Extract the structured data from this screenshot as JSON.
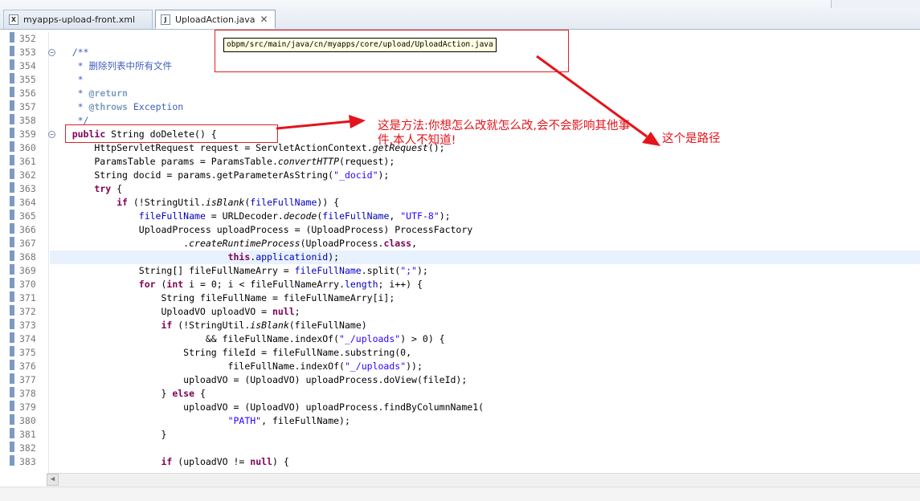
{
  "tabs": [
    {
      "icon": "X",
      "label": "myapps-upload-front.xml",
      "active": false
    },
    {
      "icon": "J",
      "label": "UploadAction.java",
      "close": "✕",
      "active": true
    }
  ],
  "editor": {
    "current_line": "368",
    "lines": [
      {
        "n": "352",
        "fold": "",
        "html": ""
      },
      {
        "n": "353",
        "fold": "⊖",
        "html": "    <span class=\"cmt\">/**</span>"
      },
      {
        "n": "354",
        "fold": "",
        "html": "     <span class=\"cmt\">* 删除列表中所有文件</span>"
      },
      {
        "n": "355",
        "fold": "",
        "html": "     <span class=\"cmt\">*</span>"
      },
      {
        "n": "356",
        "fold": "",
        "html": "     <span class=\"cmt\">* </span><span class=\"tag\">@return</span>"
      },
      {
        "n": "357",
        "fold": "",
        "html": "     <span class=\"cmt\">* </span><span class=\"tag\">@throws</span><span class=\"cmt\"> Exception</span>"
      },
      {
        "n": "358",
        "fold": "",
        "html": "     <span class=\"cmt\">*/</span>"
      },
      {
        "n": "359",
        "fold": "⊖",
        "html": "    <span class=\"kw\">public</span> String doDelete() {"
      },
      {
        "n": "360",
        "fold": "",
        "html": "        HttpServletRequest request = ServletActionContext.<span class=\"it\">getRequest</span>();"
      },
      {
        "n": "361",
        "fold": "",
        "html": "        ParamsTable params = ParamsTable.<span class=\"it\">convertHTTP</span>(request);"
      },
      {
        "n": "362",
        "fold": "",
        "html": "        String docid = params.getParameterAsString(<span class=\"str\">\"_docid\"</span>);"
      },
      {
        "n": "363",
        "fold": "",
        "html": "        <span class=\"kw\">try</span> {"
      },
      {
        "n": "364",
        "fold": "",
        "html": "            <span class=\"kw\">if</span> (!StringUtil.<span class=\"it\">isBlank</span>(<span class=\"fld\">fileFullName</span>)) {"
      },
      {
        "n": "365",
        "fold": "",
        "html": "                <span class=\"fld\">fileFullName</span> = URLDecoder.<span class=\"it\">decode</span>(<span class=\"fld\">fileFullName</span>, <span class=\"str\">\"UTF-8\"</span>);"
      },
      {
        "n": "366",
        "fold": "",
        "html": "                UploadProcess uploadProcess = (UploadProcess) ProcessFactory"
      },
      {
        "n": "367",
        "fold": "",
        "html": "                        .<span class=\"it\">createRuntimeProcess</span>(UploadProcess.<span class=\"kw\">class</span>,"
      },
      {
        "n": "368",
        "fold": "",
        "html": "                                <span class=\"kw\">this</span>.<span class=\"fld\">applicationid</span>);"
      },
      {
        "n": "369",
        "fold": "",
        "html": "                String[] fileFullNameArry = <span class=\"fld\">fileFullName</span>.split(<span class=\"str\">\";\"</span>);"
      },
      {
        "n": "370",
        "fold": "",
        "html": "                <span class=\"kw\">for</span> (<span class=\"kw\">int</span> i = 0; i &lt; fileFullNameArry.<span class=\"fld\">length</span>; i++) {"
      },
      {
        "n": "371",
        "fold": "",
        "html": "                    String fileFullName = fileFullNameArry[i];"
      },
      {
        "n": "372",
        "fold": "",
        "html": "                    UploadVO uploadVO = <span class=\"kw\">null</span>;"
      },
      {
        "n": "373",
        "fold": "",
        "html": "                    <span class=\"kw\">if</span> (!StringUtil.<span class=\"it\">isBlank</span>(fileFullName)"
      },
      {
        "n": "374",
        "fold": "",
        "html": "                            &amp;&amp; fileFullName.indexOf(<span class=\"str\">\"_/uploads\"</span>) &gt; 0) {"
      },
      {
        "n": "375",
        "fold": "",
        "html": "                        String fileId = fileFullName.substring(0,"
      },
      {
        "n": "376",
        "fold": "",
        "html": "                                fileFullName.indexOf(<span class=\"str\">\"_/uploads\"</span>));"
      },
      {
        "n": "377",
        "fold": "",
        "html": "                        uploadVO = (UploadVO) uploadProcess.doView(fileId);"
      },
      {
        "n": "378",
        "fold": "",
        "html": "                    } <span class=\"kw\">else</span> {"
      },
      {
        "n": "379",
        "fold": "",
        "html": "                        uploadVO = (UploadVO) uploadProcess.findByColumnName1("
      },
      {
        "n": "380",
        "fold": "",
        "html": "                                <span class=\"str\">\"PATH\"</span>, fileFullName);"
      },
      {
        "n": "381",
        "fold": "",
        "html": "                    }"
      },
      {
        "n": "382",
        "fold": "",
        "html": ""
      },
      {
        "n": "383",
        "fold": "",
        "html": "                    <span class=\"kw\">if</span> (uploadVO != <span class=\"kw\">null</span>) {"
      }
    ]
  },
  "tooltip": {
    "text": "obpm/src/main/java/cn/myapps/core/upload/UploadAction.java"
  },
  "annotations": {
    "method_note": "这是方法:你想怎么改就怎么改,会不会影响其他事件,本人不知道!",
    "path_note": "这个是路径"
  },
  "colors": {
    "annotation_red": "#e4141c",
    "tooltip_bg": "#ffffe1",
    "current_line_bg": "#e8f2fe"
  },
  "scrollbar": {
    "left_arrow": "◀"
  }
}
